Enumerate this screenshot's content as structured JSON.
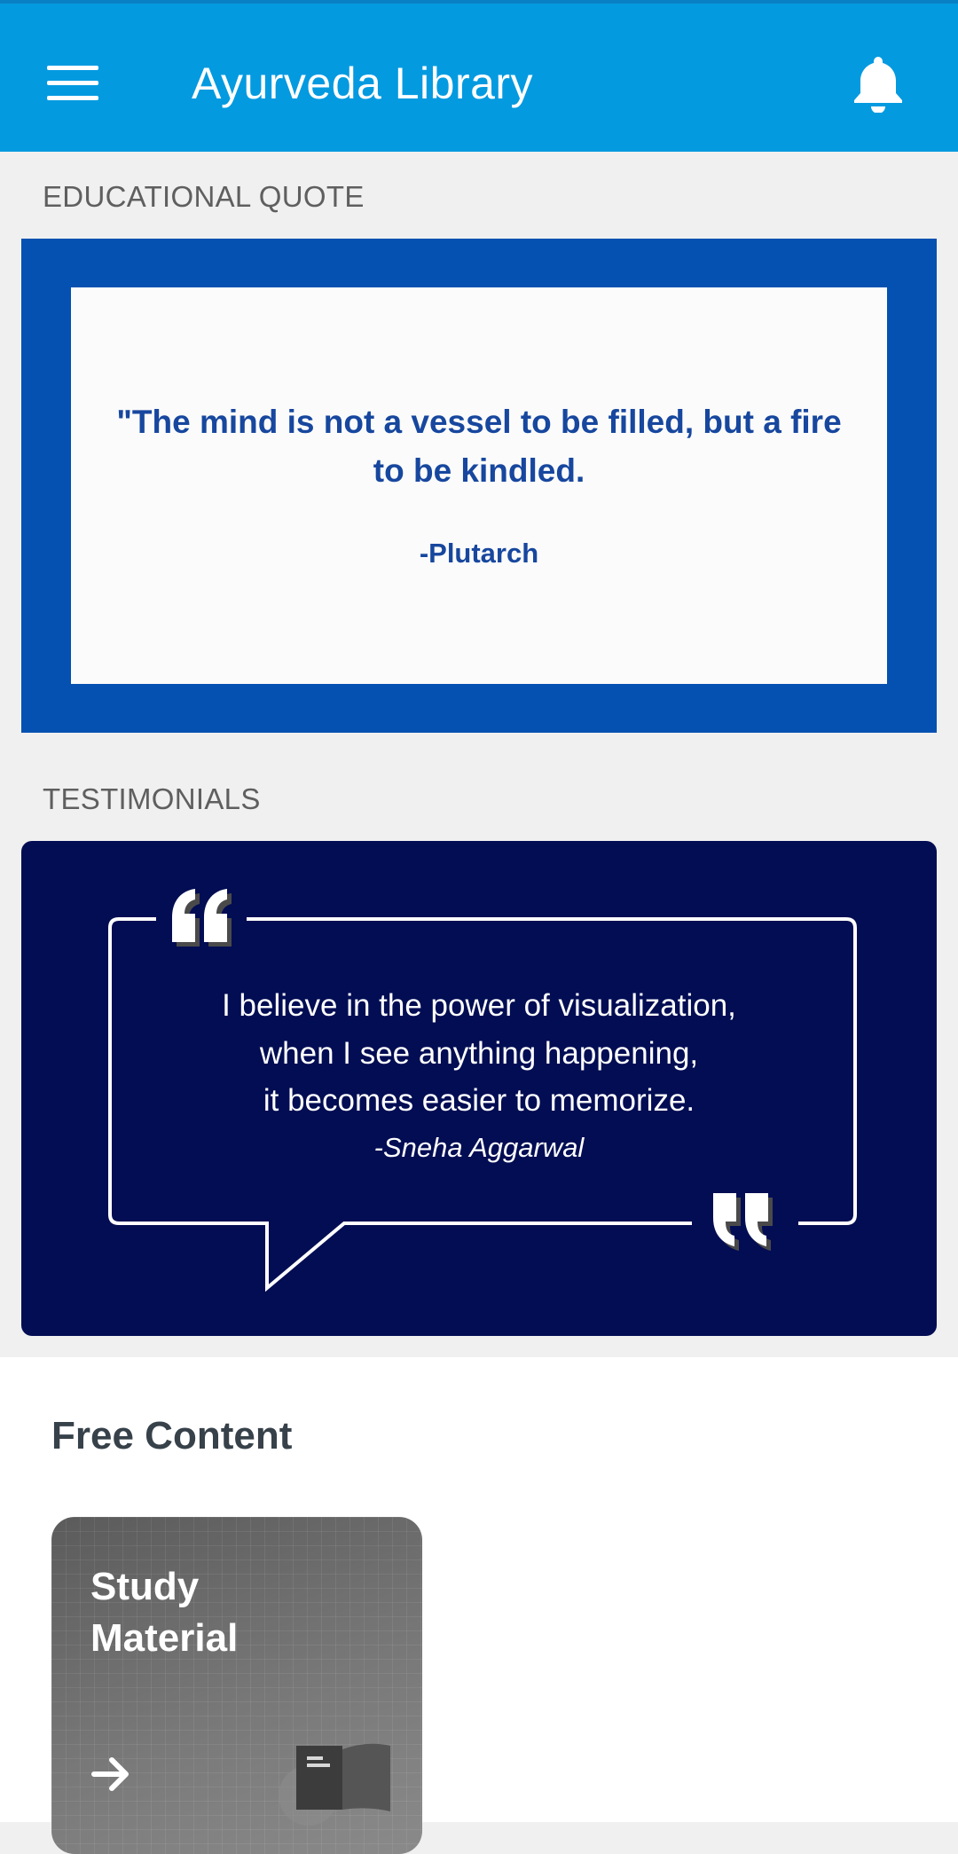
{
  "app_bar": {
    "title": "Ayurveda Library",
    "menu_icon": "hamburger-menu-icon",
    "notification_icon": "bell-icon",
    "color": "#039ae0"
  },
  "educational_quote": {
    "label": "EDUCATIONAL QUOTE",
    "quote": "\"The mind is not a vessel to be filled, but a fire to be kindled.",
    "author": "-Plutarch",
    "frame_color": "#0451b1",
    "text_color": "#17479e"
  },
  "testimonials": {
    "label": "TESTIMONIALS",
    "lines": [
      "I believe in the power of visualization,",
      "when I see anything happening,",
      "it becomes easier to memorize."
    ],
    "author": "-Sneha Aggarwal",
    "background_color": "#020d53"
  },
  "free_content": {
    "title": "Free Content",
    "cards": [
      {
        "title": "Study Material",
        "action_icon": "arrow-right-icon",
        "illustration_icon": "book-icon"
      }
    ]
  }
}
